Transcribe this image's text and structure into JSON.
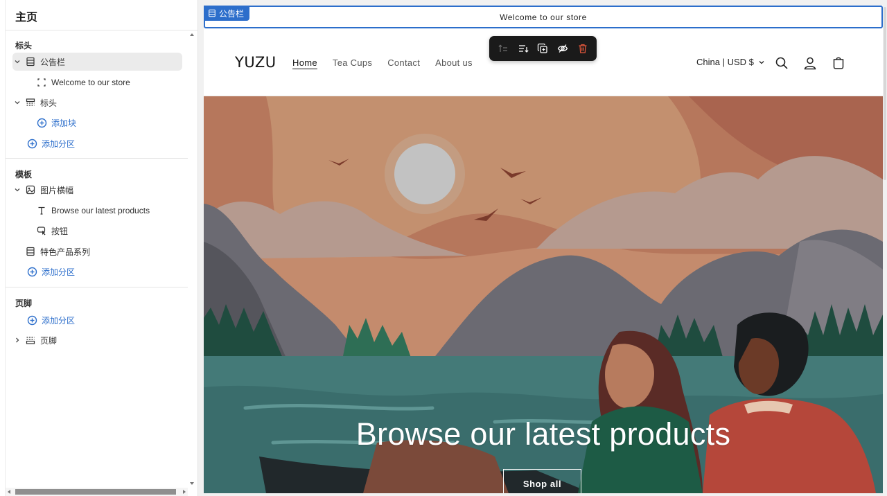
{
  "sidebar": {
    "title": "主页",
    "groups": {
      "header": {
        "label": "标头",
        "announcement_item": "公告栏",
        "announcement_child": "Welcome to our store",
        "header_item": "标头",
        "add_block": "添加块",
        "add_section": "添加分区"
      },
      "template": {
        "label": "模板",
        "banner_item": "图片横幅",
        "banner_text_child": "Browse our latest products",
        "banner_button_child": "按钮",
        "featured_collection": "特色产品系列",
        "add_section": "添加分区"
      },
      "footer": {
        "label": "页脚",
        "add_section": "添加分区",
        "footer_item": "页脚"
      }
    }
  },
  "preview": {
    "selection_tag": "公告栏",
    "announcement_text": "Welcome to our store",
    "store": {
      "logo": "YUZU",
      "nav": [
        "Home",
        "Tea Cups",
        "Contact",
        "About us"
      ],
      "currency": "China | USD $"
    },
    "hero": {
      "heading": "Browse our latest products",
      "button": "Shop all"
    }
  },
  "icons": {
    "toolbar": [
      "move-up-icon",
      "move-down-icon",
      "duplicate-icon",
      "hide-icon",
      "delete-icon"
    ],
    "header": [
      "search-icon",
      "account-icon",
      "cart-icon"
    ]
  },
  "colors": {
    "accent": "#2c6ecb",
    "delete": "#e0563b",
    "toolbar_bg": "#1a1a1a"
  }
}
